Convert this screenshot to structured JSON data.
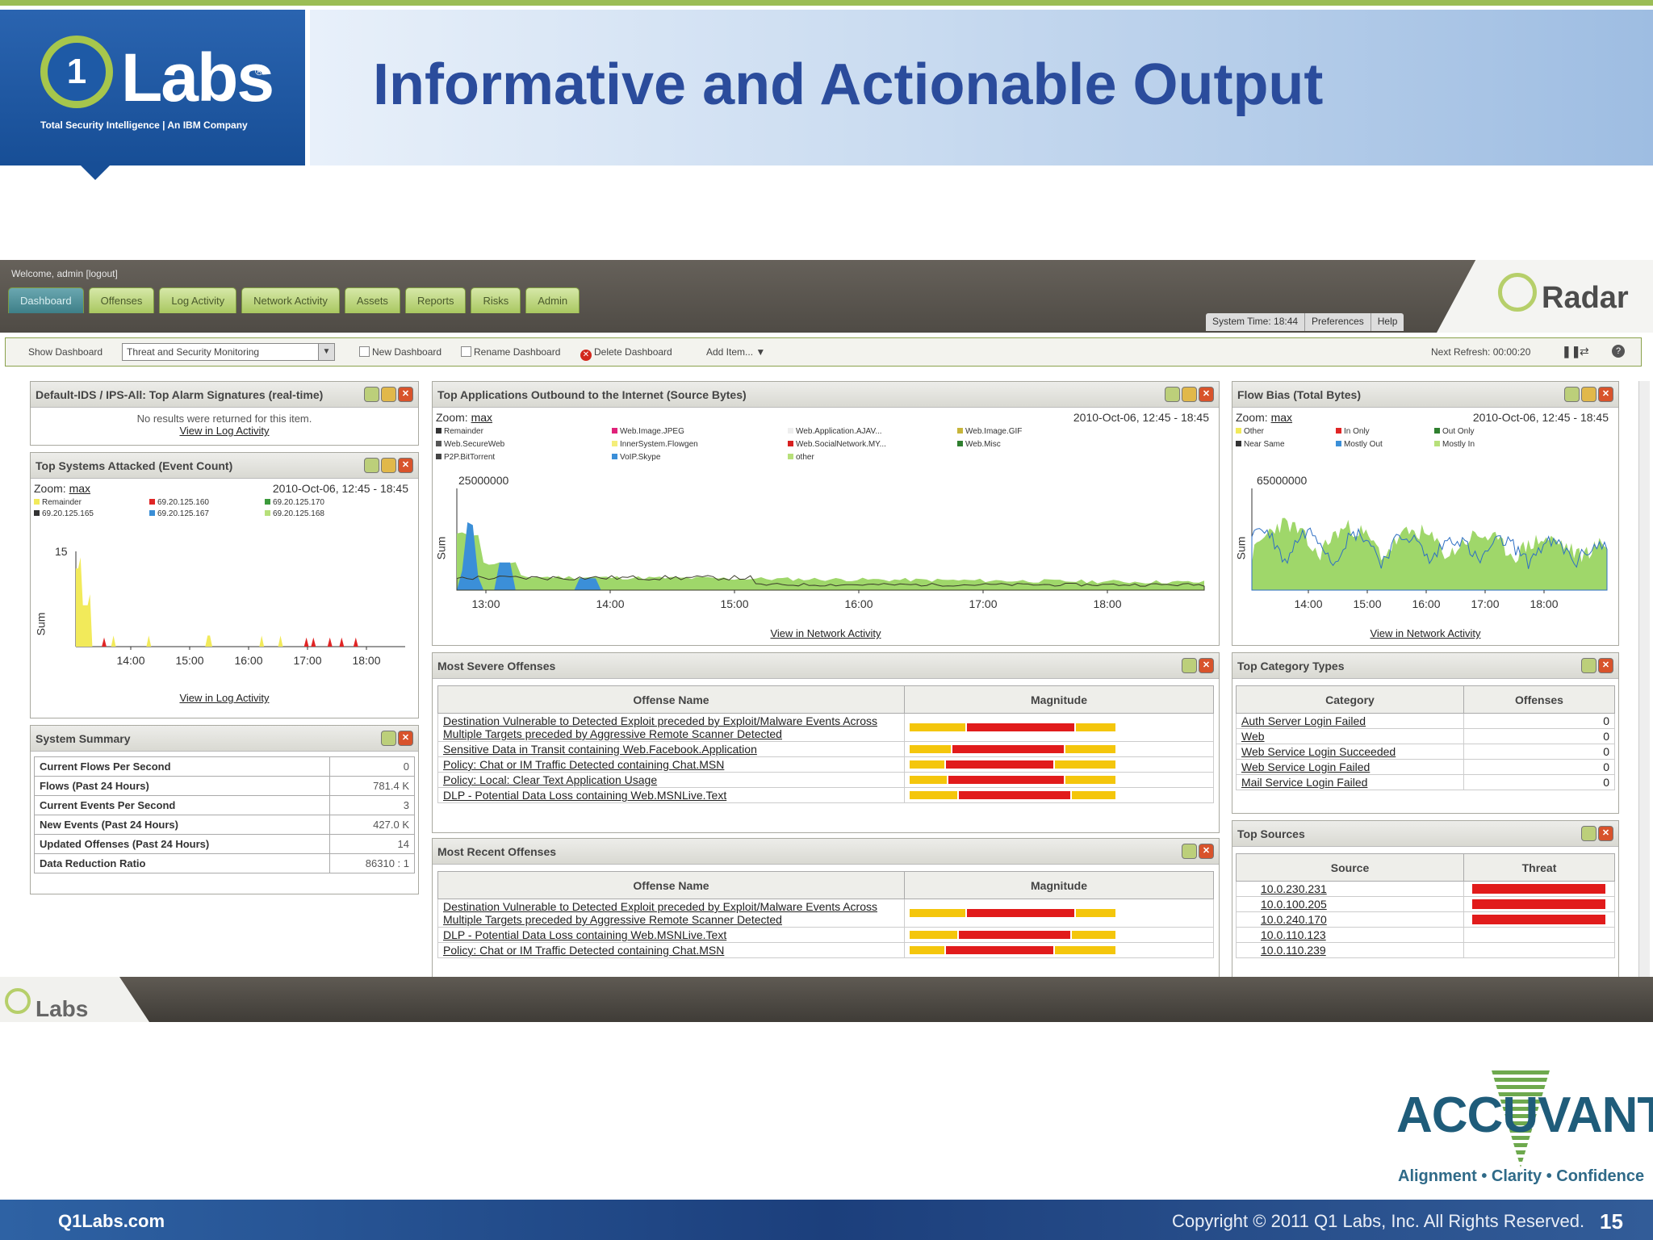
{
  "slide": {
    "title": "Informative and Actionable Output",
    "logo": {
      "digit": "1",
      "word": "Labs",
      "reg": "®",
      "tagline": "Total Security Intelligence | An IBM Company"
    },
    "footer_site": "Q1Labs.com",
    "copyright": "Copyright © 2011 Q1 Labs, Inc. All Rights Reserved.",
    "page_number": "15",
    "brand": {
      "word": "ACCUVANT",
      "tagline": "Alignment • Clarity • Confidence"
    },
    "footer_logo": "Labs",
    "colors": {
      "brand_blue": "#2b4c9c",
      "accent_green": "#9bbd55",
      "red": "#e11b1b",
      "yellow": "#f4c60c"
    }
  },
  "app": {
    "welcome": "Welcome, admin [logout]",
    "tabs": [
      "Dashboard",
      "Offenses",
      "Log Activity",
      "Network Activity",
      "Assets",
      "Reports",
      "Risks",
      "Admin"
    ],
    "active_tab": "Dashboard",
    "system_time": "System Time: 18:44",
    "preferences": "Preferences",
    "help": "Help",
    "radar": "Radar",
    "toolbar": {
      "show_label": "Show Dashboard",
      "dashboard_value": "Threat and Security Monitoring",
      "new": "New Dashboard",
      "rename": "Rename Dashboard",
      "delete": "Delete Dashboard",
      "add": "Add Item...",
      "refresh": "Next Refresh: 00:00:20"
    }
  },
  "panels": {
    "ids": {
      "title": "Default-IDS / IPS-All: Top Alarm Signatures (real-time)",
      "message": "No results were returned for this item.",
      "link": "View in Log Activity"
    },
    "attacked": {
      "title": "Top Systems Attacked (Event Count)",
      "zoom_label": "Zoom:",
      "zoom": "max",
      "range": "2010-Oct-06, 12:45 - 18:45",
      "legend": [
        {
          "label": "Remainder",
          "color": "#f2ea5a"
        },
        {
          "label": "69.20.125.160",
          "color": "#e02525"
        },
        {
          "label": "69.20.125.170",
          "color": "#3c9a3c"
        },
        {
          "label": "69.20.125.165",
          "color": "#333333"
        },
        {
          "label": "69.20.125.167",
          "color": "#3a8ed6"
        },
        {
          "label": "69.20.125.168",
          "color": "#b7e07a"
        }
      ],
      "ymax": "15",
      "ylabel": "Sum",
      "ticks": [
        "14:00",
        "15:00",
        "16:00",
        "17:00",
        "18:00"
      ],
      "link": "View in Log Activity"
    },
    "summary": {
      "title": "System Summary",
      "rows": [
        {
          "k": "Current Flows Per Second",
          "v": "0"
        },
        {
          "k": "Flows (Past 24 Hours)",
          "v": "781.4 K"
        },
        {
          "k": "Current Events Per Second",
          "v": "3"
        },
        {
          "k": "New Events (Past 24 Hours)",
          "v": "427.0 K"
        },
        {
          "k": "Updated Offenses (Past 24 Hours)",
          "v": "14"
        },
        {
          "k": "Data Reduction Ratio",
          "v": "86310 : 1"
        }
      ]
    },
    "apps": {
      "title": "Top Applications Outbound to the Internet (Source Bytes)",
      "zoom_label": "Zoom:",
      "zoom": "max",
      "range": "2010-Oct-06, 12:45 - 18:45",
      "legend": [
        {
          "label": "Remainder",
          "color": "#333333"
        },
        {
          "label": "Web.Image.JPEG",
          "color": "#e0227a"
        },
        {
          "label": "Web.Application.AJAV...",
          "color": "#eeeeee"
        },
        {
          "label": "Web.Image.GIF",
          "color": "#c7b53a"
        },
        {
          "label": "Web.SecureWeb",
          "color": "#555555"
        },
        {
          "label": "InnerSystem.Flowgen",
          "color": "#f4ee7a"
        },
        {
          "label": "Web.SocialNetwork.MY...",
          "color": "#d82020"
        },
        {
          "label": "Web.Misc",
          "color": "#2f7f2f"
        },
        {
          "label": "P2P.BitTorrent",
          "color": "#444444"
        },
        {
          "label": "VoIP.Skype",
          "color": "#3b8fd8"
        },
        {
          "label": "other",
          "color": "#b7e07a"
        }
      ],
      "ymax": "25000000",
      "ylabel": "Sum",
      "ticks": [
        "13:00",
        "14:00",
        "15:00",
        "16:00",
        "17:00",
        "18:00"
      ],
      "link": "View in Network Activity"
    },
    "flow": {
      "title": "Flow Bias (Total Bytes)",
      "zoom_label": "Zoom:",
      "zoom": "max",
      "range": "2010-Oct-06, 12:45 - 18:45",
      "legend": [
        {
          "label": "Other",
          "color": "#f2ea5a"
        },
        {
          "label": "In Only",
          "color": "#e02525"
        },
        {
          "label": "Out Only",
          "color": "#2f7f2f"
        },
        {
          "label": "Near Same",
          "color": "#333333"
        },
        {
          "label": "Mostly Out",
          "color": "#3b8fd8"
        },
        {
          "label": "Mostly In",
          "color": "#b7e07a"
        }
      ],
      "ymax": "65000000",
      "ylabel": "Sum",
      "ticks": [
        "14:00",
        "15:00",
        "16:00",
        "17:00",
        "18:00"
      ],
      "link": "View in Network Activity"
    },
    "severe": {
      "title": "Most Severe Offenses",
      "col1": "Offense Name",
      "col2": "Magnitude",
      "rows": [
        {
          "name": "Destination Vulnerable to Detected Exploit preceded by Exploit/Malware Events Across Multiple Targets preceded by Aggressive Remote Scanner Detected",
          "mag": [
            0.27,
            0.53,
            0.2
          ]
        },
        {
          "name": "Sensitive Data in Transit containing Web.Facebook.Application",
          "mag": [
            0.2,
            0.55,
            0.25
          ]
        },
        {
          "name": "Policy: Chat or IM Traffic Detected containing Chat.MSN",
          "mag": [
            0.17,
            0.53,
            0.3
          ]
        },
        {
          "name": "Policy: Local: Clear Text Application Usage",
          "mag": [
            0.18,
            0.57,
            0.25
          ]
        },
        {
          "name": "DLP - Potential Data Loss containing Web.MSNLive.Text",
          "mag": [
            0.23,
            0.55,
            0.22
          ]
        }
      ]
    },
    "recent": {
      "title": "Most Recent Offenses",
      "col1": "Offense Name",
      "col2": "Magnitude",
      "rows": [
        {
          "name": "Destination Vulnerable to Detected Exploit preceded by Exploit/Malware Events Across Multiple Targets preceded by Aggressive Remote Scanner Detected",
          "mag": [
            0.27,
            0.53,
            0.2
          ]
        },
        {
          "name": "DLP - Potential Data Loss containing Web.MSNLive.Text",
          "mag": [
            0.23,
            0.55,
            0.22
          ]
        },
        {
          "name": "Policy: Chat or IM Traffic Detected containing Chat.MSN",
          "mag": [
            0.17,
            0.53,
            0.3
          ]
        }
      ]
    },
    "categories": {
      "title": "Top Category Types",
      "col1": "Category",
      "col2": "Offenses",
      "rows": [
        {
          "c": "Auth Server Login Failed",
          "n": "0"
        },
        {
          "c": "Web",
          "n": "0"
        },
        {
          "c": "Web Service Login Succeeded",
          "n": "0"
        },
        {
          "c": "Web Service Login Failed",
          "n": "0"
        },
        {
          "c": "Mail Service Login Failed",
          "n": "0"
        }
      ]
    },
    "sources": {
      "title": "Top Sources",
      "col1": "Source",
      "col2": "Threat",
      "rows": [
        {
          "s": "10.0.230.231",
          "t": 1.0
        },
        {
          "s": "10.0.100.205",
          "t": 1.0
        },
        {
          "s": "10.0.240.170",
          "t": 1.0
        },
        {
          "s": "10.0.110.123",
          "t": 0
        },
        {
          "s": "10.0.110.239",
          "t": 0
        }
      ]
    }
  }
}
